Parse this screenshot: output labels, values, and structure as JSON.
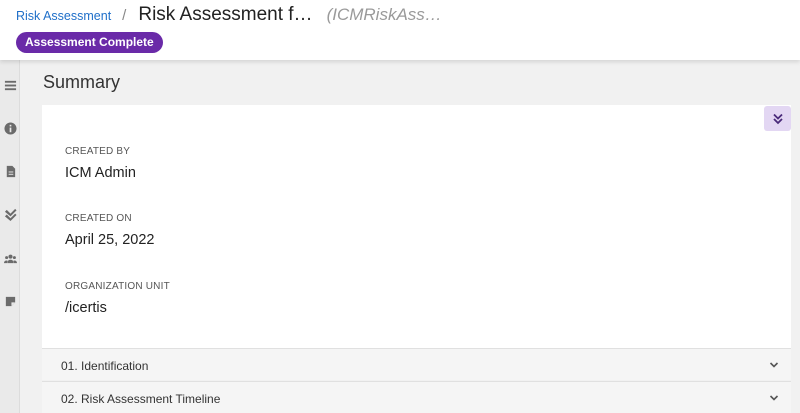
{
  "breadcrumb": {
    "parent_label": "Risk Assessment",
    "separator": "/",
    "title": "Risk Assessment f…",
    "record_id": "(ICMRiskAss…"
  },
  "status": {
    "label": "Assessment Complete",
    "color": "#6a2aa8"
  },
  "rail": {
    "icons": [
      "menu-icon",
      "info-icon",
      "document-icon",
      "double-check-icon",
      "users-icon",
      "note-icon"
    ]
  },
  "summary": {
    "title": "Summary",
    "collapse_icon": "chevron-double-down-icon",
    "fields": [
      {
        "label": "CREATED BY",
        "value": "ICM Admin"
      },
      {
        "label": "CREATED ON",
        "value": "April 25, 2022"
      },
      {
        "label": "ORGANIZATION UNIT",
        "value": "/icertis"
      }
    ]
  },
  "sections": [
    {
      "label": "01. Identification"
    },
    {
      "label": "02. Risk Assessment Timeline"
    }
  ],
  "colors": {
    "link": "#1f6fc9",
    "badge": "#6a2aa8",
    "collapse_button_bg": "#e3d7f3"
  }
}
